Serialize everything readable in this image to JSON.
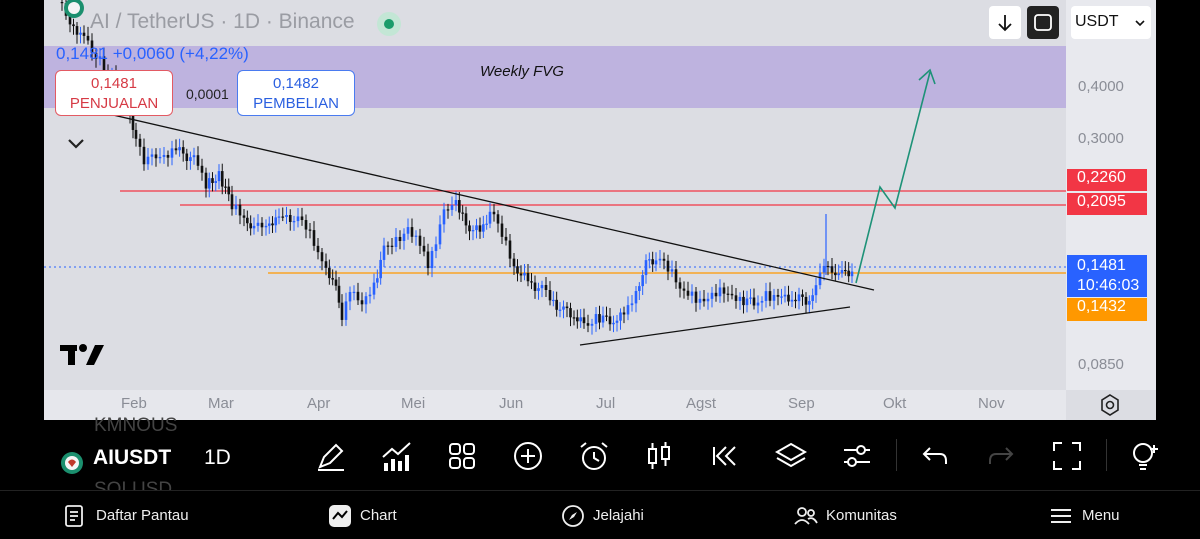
{
  "header": {
    "symbol_title": "AI / TetherUS · 1D · Binance",
    "last_price_line": "0,1481 +0,0060 (+4,22%)",
    "sell_price": "0,1481",
    "sell_label": "PENJUALAN",
    "spread": "0,0001",
    "buy_price": "0,1482",
    "buy_label": "PEMBELIAN",
    "currency": "USDT"
  },
  "annotations": {
    "fvg_label": "Weekly FVG"
  },
  "price_axis": {
    "ticks": [
      "0,4000",
      "0,3000",
      "0,0850"
    ],
    "resistance_1": "0,2260",
    "resistance_2": "0,2095",
    "current_price": "0,1481",
    "countdown": "10:46:03",
    "support": "0,1432"
  },
  "time_axis": {
    "months": [
      "Feb",
      "Mar",
      "Apr",
      "Mei",
      "Jun",
      "Jul",
      "Agst",
      "Sep",
      "Okt",
      "Nov"
    ]
  },
  "toolbar": {
    "symbol": "AIUSDT",
    "interval": "1D",
    "ghost_top": "KMNOUS",
    "ghost_bottom": "SOLUSD"
  },
  "bottom_nav": {
    "watchlist": "Daftar Pantau",
    "chart": "Chart",
    "explore": "Jelajahi",
    "community": "Komunitas",
    "menu": "Menu"
  },
  "colors": {
    "accent_blue": "#2962ff",
    "resistance_red": "#f23645",
    "support_orange": "#ff9800",
    "fvg_purple": "#b9abde",
    "projection_green": "#26a69a"
  }
}
